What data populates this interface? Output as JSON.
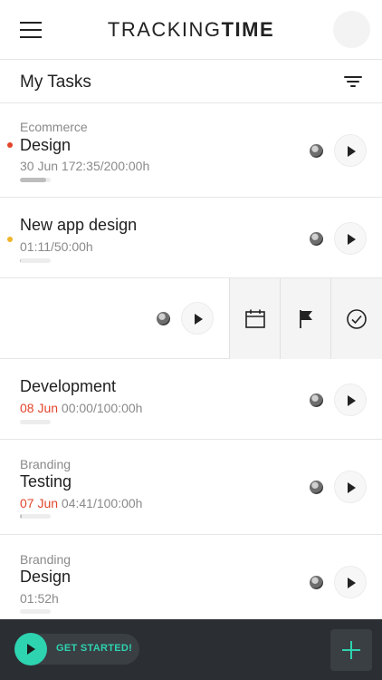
{
  "header": {
    "brand_part1": "TRACKING",
    "brand_part2": "TIME"
  },
  "section": {
    "title": "My Tasks"
  },
  "tasks": [
    {
      "project": "Ecommerce",
      "name": "Design",
      "due": "",
      "meta": "30 Jun 172:35/200:00h",
      "progress": 0.86,
      "dot_color": "#e3452b"
    },
    {
      "project": "",
      "name": "New app design",
      "due": "",
      "meta": "01:11/50:00h",
      "progress": 0.02,
      "dot_color": "#f0b429"
    },
    {
      "project": "",
      "name": "Development",
      "due": "08 Jun",
      "meta": " 00:00/100:00h",
      "progress": 0.0,
      "dot_color": ""
    },
    {
      "project": "Branding",
      "name": "Testing",
      "due": "07 Jun",
      "meta": " 04:41/100:00h",
      "progress": 0.05,
      "dot_color": ""
    },
    {
      "project": "Branding",
      "name": "Design",
      "due": "",
      "meta": "01:52h",
      "progress": 0.0,
      "dot_color": ""
    }
  ],
  "swipe_actions": [
    "calendar-icon",
    "flag-icon",
    "check-circle-icon"
  ],
  "bottom": {
    "get_started_label": "GET STARTED!",
    "accent": "#2ed3b0"
  }
}
